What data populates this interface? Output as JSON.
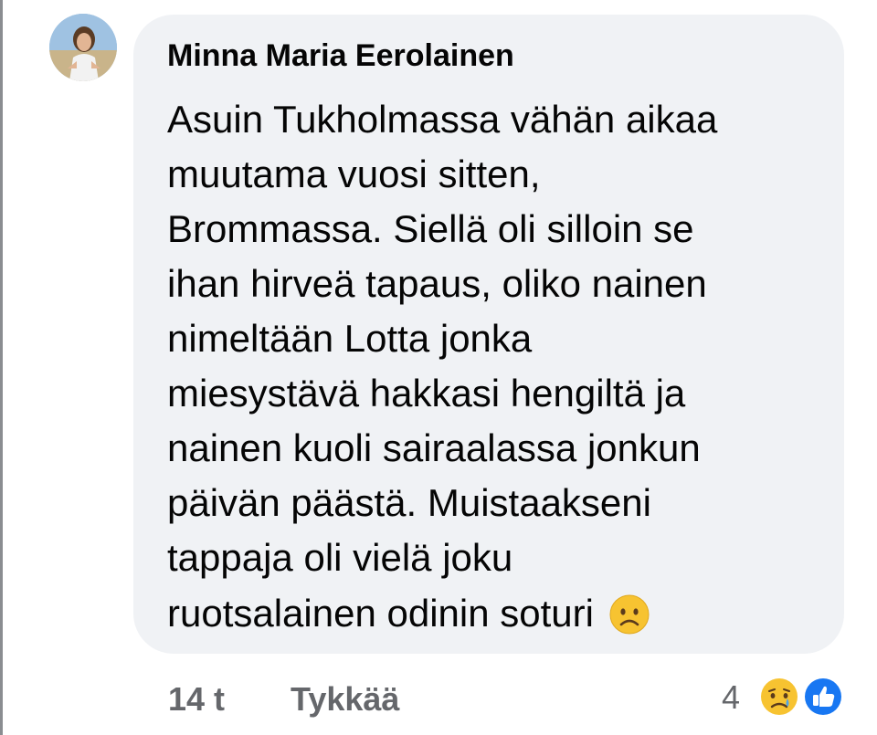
{
  "comment": {
    "author": "Minna Maria Eerolainen",
    "lines": [
      "Asuin Tukholmassa vähän aikaa",
      "muutama vuosi sitten,",
      "Brommassa. Siellä oli silloin se",
      "ihan hirveä tapaus, oliko nainen",
      "nimeltään Lotta jonka",
      "miesystävä hakkasi hengiltä ja",
      "nainen kuoli sairaalassa jonkun",
      "päivän päästä. Muistaakseni",
      "tappaja oli vielä joku",
      "ruotsalainen odinin soturi"
    ],
    "trailing_emoji": "frowning-face"
  },
  "footer": {
    "time": "14 t",
    "like_label": "Tykkää"
  },
  "reactions": {
    "count": "4",
    "icons": [
      "sad-reaction",
      "like-reaction"
    ]
  },
  "colors": {
    "bubble": "#f0f2f5",
    "text": "#050505",
    "muted": "#65676b",
    "like_blue": "#1877f2",
    "emoji_yellow": "#f7c331"
  }
}
